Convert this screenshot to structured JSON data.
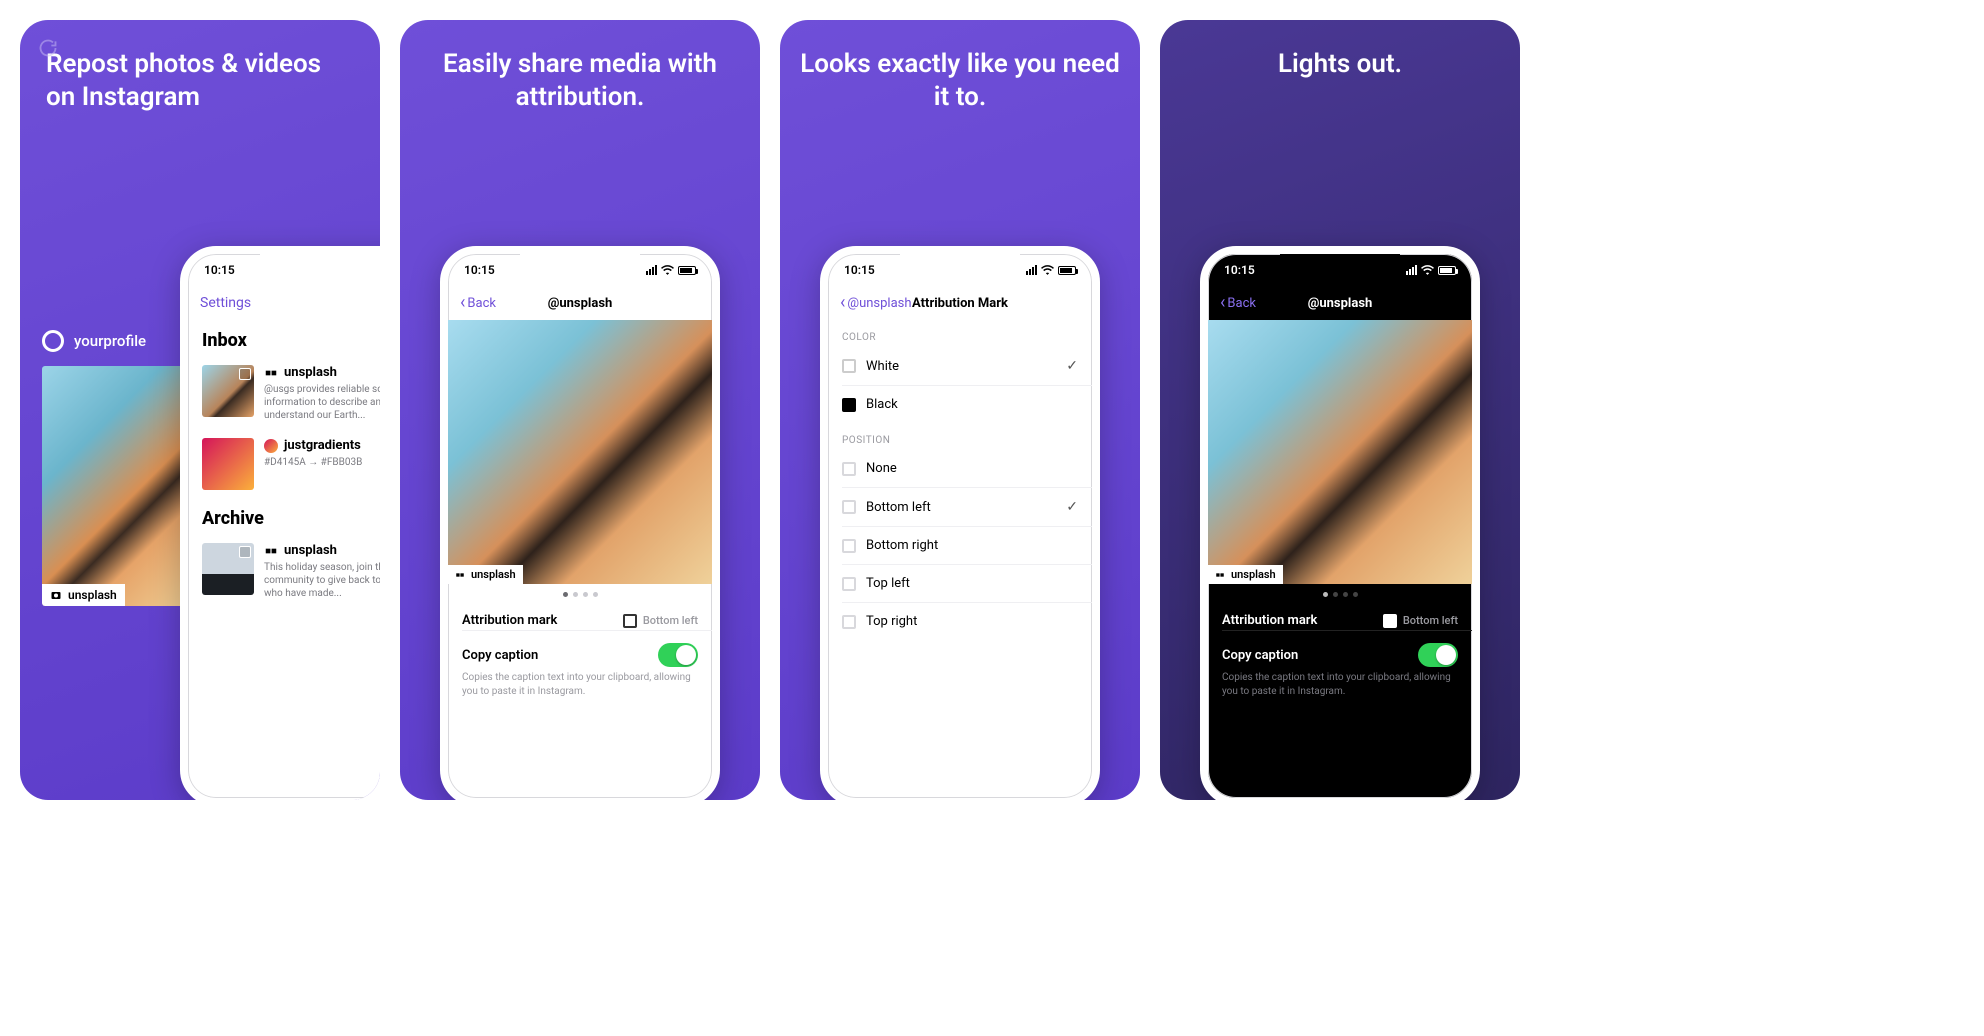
{
  "panels": {
    "p1": {
      "headline": "Repost photos & videos on Instagram",
      "profile": "yourprofile",
      "badge": "unsplash",
      "phone": {
        "time": "10:15",
        "nav_left": "Settings",
        "sections": {
          "inbox": "Inbox",
          "archive": "Archive"
        },
        "rows": {
          "r1_user": "unsplash",
          "r1_sub": "@usgs provides reliable scientific information to describe and understand our Earth...",
          "r2_user": "justgradients",
          "r2_sub": "#D4145A → #FBB03B",
          "r3_user": "unsplash",
          "r3_sub": "This holiday season, join the community to give back to the people who have made..."
        }
      }
    },
    "p2": {
      "headline": "Easily share media with attribution.",
      "phone": {
        "time": "10:15",
        "back": "Back",
        "title": "@unsplash",
        "badge": "unsplash",
        "attr_label": "Attribution mark",
        "attr_value": "Bottom left",
        "copy_label": "Copy caption",
        "copy_help": "Copies the caption text into your clipboard, allowing you to paste it in Instagram."
      }
    },
    "p3": {
      "headline": "Looks exactly like you need it to.",
      "phone": {
        "time": "10:15",
        "back": "@unsplash",
        "title": "Attribution Mark",
        "group_color": "COLOR",
        "color_white": "White",
        "color_black": "Black",
        "group_position": "POSITION",
        "pos_none": "None",
        "pos_bl": "Bottom left",
        "pos_br": "Bottom right",
        "pos_tl": "Top left",
        "pos_tr": "Top right"
      }
    },
    "p4": {
      "headline": "Lights out.",
      "phone": {
        "time": "10:15",
        "back": "Back",
        "title": "@unsplash",
        "badge": "unsplash",
        "attr_label": "Attribution mark",
        "attr_value": "Bottom left",
        "copy_label": "Copy caption",
        "copy_help": "Copies the caption text into your clipboard, allowing you to paste it in Instagram."
      }
    }
  }
}
